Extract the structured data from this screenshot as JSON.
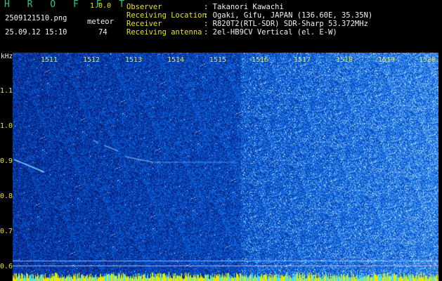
{
  "header": {
    "app_title": "H R O F F T",
    "app_version": "1.0.0",
    "filename": "2509121510.png",
    "timestamp": "25.09.12 15:10",
    "meteor_label": "meteor",
    "meteor_count": "74",
    "fields": [
      {
        "label": "Observer",
        "value": ": Takanori Kawachi"
      },
      {
        "label": "Receiving Location",
        "value": ": Ogaki, Gifu, JAPAN (136.60E, 35.35N)"
      },
      {
        "label": "Receiver",
        "value": ": R820T2(RTL-SDR) SDR-Sharp 53.372MHz"
      },
      {
        "label": "Receiving antenna",
        "value": ": 2el-HB9CV Vertical (el. E-W)"
      }
    ]
  },
  "axes": {
    "y_unit": "kHz",
    "x_ticks": [
      "1511",
      "1512",
      "1513",
      "1514",
      "1515",
      "1516",
      "1517",
      "1518",
      "1519",
      "1520"
    ],
    "y_ticks": [
      "1.1",
      "1.0",
      "0.9",
      "0.8",
      "0.7",
      "0.6"
    ]
  },
  "colors": {
    "background": "#000000",
    "spectrogram_dark": "#0a1a8a",
    "noise_light": "#3fe0ff",
    "tick_text": "#e8e800",
    "header_text": "#f2f2f2",
    "title_green": "#2fc27b"
  }
}
